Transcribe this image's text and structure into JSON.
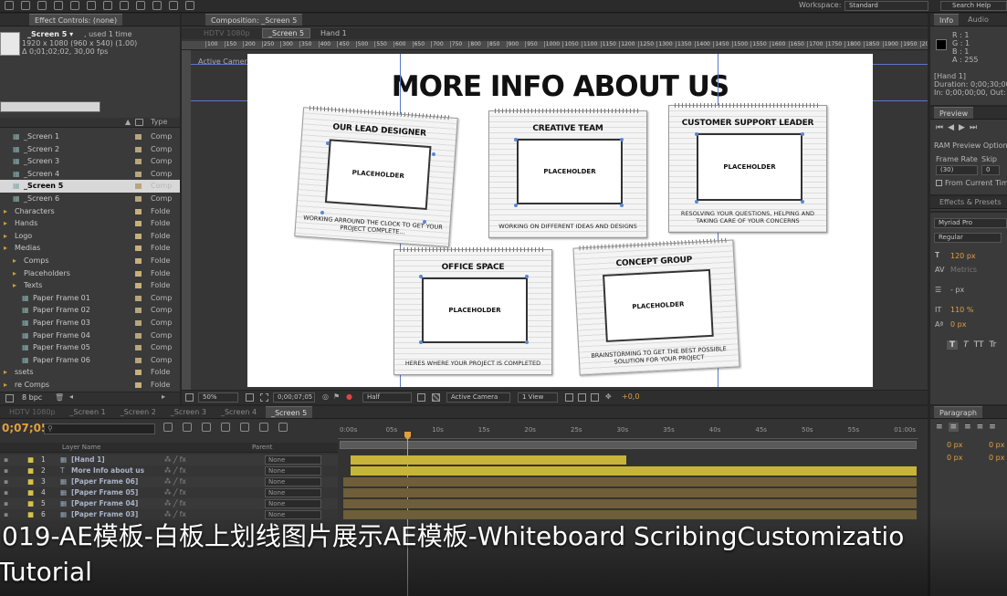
{
  "top_bar": {
    "workspace_label": "Workspace:",
    "workspace_value": "Standard",
    "search_help": "Search Help"
  },
  "effect_controls": {
    "tab": "Effect Controls: (none)"
  },
  "project": {
    "name": "_Screen 5 ▾",
    "used": ", used 1 time",
    "dims": "1920 x 1080  (960 x 540) (1.00)",
    "duration": "Δ 0;01;02;02, 30,00 fps",
    "col_type": "Type",
    "items": [
      {
        "name": "_Screen 1",
        "type": "Comp",
        "indent": 1,
        "kind": "comp"
      },
      {
        "name": "_Screen 2",
        "type": "Comp",
        "indent": 1,
        "kind": "comp"
      },
      {
        "name": "_Screen 3",
        "type": "Comp",
        "indent": 1,
        "kind": "comp"
      },
      {
        "name": "_Screen 4",
        "type": "Comp",
        "indent": 1,
        "kind": "comp"
      },
      {
        "name": "_Screen 5",
        "type": "Comp",
        "indent": 1,
        "kind": "comp",
        "selected": true
      },
      {
        "name": "_Screen 6",
        "type": "Comp",
        "indent": 1,
        "kind": "comp"
      },
      {
        "name": "Characters",
        "type": "Folde",
        "indent": 0,
        "kind": "folder"
      },
      {
        "name": "Hands",
        "type": "Folde",
        "indent": 0,
        "kind": "folder"
      },
      {
        "name": "Logo",
        "type": "Folde",
        "indent": 0,
        "kind": "folder"
      },
      {
        "name": "Medias",
        "type": "Folde",
        "indent": 0,
        "kind": "folder"
      },
      {
        "name": "Comps",
        "type": "Folde",
        "indent": 1,
        "kind": "folder"
      },
      {
        "name": "Placeholders",
        "type": "Folde",
        "indent": 1,
        "kind": "folder"
      },
      {
        "name": "Texts",
        "type": "Folde",
        "indent": 1,
        "kind": "folder"
      },
      {
        "name": "Paper Frame 01",
        "type": "Comp",
        "indent": 2,
        "kind": "comp"
      },
      {
        "name": "Paper Frame 02",
        "type": "Comp",
        "indent": 2,
        "kind": "comp"
      },
      {
        "name": "Paper Frame 03",
        "type": "Comp",
        "indent": 2,
        "kind": "comp"
      },
      {
        "name": "Paper Frame 04",
        "type": "Comp",
        "indent": 2,
        "kind": "comp"
      },
      {
        "name": "Paper Frame 05",
        "type": "Comp",
        "indent": 2,
        "kind": "comp"
      },
      {
        "name": "Paper Frame 06",
        "type": "Comp",
        "indent": 2,
        "kind": "comp"
      },
      {
        "name": "ssets",
        "type": "Folde",
        "indent": 0,
        "kind": "folder"
      },
      {
        "name": "re Comps",
        "type": "Folde",
        "indent": 0,
        "kind": "folder"
      }
    ],
    "bpc": "8 bpc"
  },
  "composition": {
    "tab": "Composition: _Screen 5",
    "breadcrumb_dim": "HDTV 1080p",
    "breadcrumb": "_Screen 5",
    "breadcrumb_next": "Hand 1",
    "active_camera": "Active Camera",
    "ruler": [
      "100",
      "150",
      "200",
      "250",
      "300",
      "350",
      "400",
      "450",
      "500",
      "550",
      "600",
      "650",
      "700",
      "750",
      "800",
      "850",
      "900",
      "950",
      "1000",
      "1050",
      "1100",
      "1150",
      "1200",
      "1250",
      "1300",
      "1350",
      "1400",
      "1450",
      "1500",
      "1550",
      "1600",
      "1650",
      "1700",
      "1750",
      "1800",
      "1850",
      "1900",
      "1950",
      "2000"
    ],
    "zoom": "50%",
    "timecode": "0;00;07;05",
    "resolution": "Half",
    "camera": "Active Camera",
    "view": "1 View",
    "exposure": "+0,0"
  },
  "canvas": {
    "title": "MORE INFO ABOUT US",
    "cards": [
      {
        "title": "OUR LEAD DESIGNER",
        "placeholder": "PLACEHOLDER",
        "caption": "WORKING ARROUND THE CLOCK TO GET YOUR PROJECT COMPLETE..."
      },
      {
        "title": "CREATIVE TEAM",
        "placeholder": "PLACEHOLDER",
        "caption": "WORKING ON DIFFERENT IDEAS AND DESIGNS"
      },
      {
        "title": "CUSTOMER SUPPORT LEADER",
        "placeholder": "PLACEHOLDER",
        "caption": "RESOLVING YOUR QUESTIONS, HELPING AND TAKING CARE OF YOUR CONCERNS"
      },
      {
        "title": "OFFICE SPACE",
        "placeholder": "PLACEHOLDER",
        "caption": "HERES WHERE YOUR PROJECT IS COMPLETED"
      },
      {
        "title": "CONCEPT GROUP",
        "placeholder": "PLACEHOLDER",
        "caption": "BRAINSTORMING TO GET THE BEST POSSIBLE SOLUTION FOR YOUR PROJECT"
      }
    ]
  },
  "info": {
    "tab": "Info",
    "tab2": "Audio",
    "r": "R : 1",
    "g": "G : 1",
    "b": "B : 1",
    "a": "A : 255",
    "layer": "[Hand 1]",
    "duration": "Duration: 0;00;30;00",
    "inout": "In: 0;00;00;00, Out: 0"
  },
  "preview": {
    "tab": "Preview",
    "ram": "RAM Preview Option",
    "frame_rate": "Frame Rate",
    "skip": "Skip",
    "frame_rate_val": "(30)",
    "skip_val": "0",
    "from_current": "From Current Time"
  },
  "effects": {
    "tab": "Effects & Presets"
  },
  "character": {
    "font": "Myriad Pro",
    "style": "Regular",
    "size": "120 px",
    "metrics": "Metrics",
    "unit": "- px",
    "vscale": "110 %",
    "baseline": "0 px",
    "b1": "T",
    "b2": "T",
    "b3": "TT",
    "b4": "Tr"
  },
  "timeline": {
    "tabs": [
      "HDTV 1080p",
      "_Screen 1",
      "_Screen 2",
      "_Screen 3",
      "_Screen 4",
      "_Screen 5"
    ],
    "timecode": "0;07;05",
    "ticks": [
      "0:00s",
      "05s",
      "10s",
      "15s",
      "20s",
      "25s",
      "30s",
      "35s",
      "40s",
      "45s",
      "50s",
      "55s",
      "01:00s"
    ],
    "col_name": "Layer Name",
    "col_parent": "Parent",
    "layers": [
      {
        "num": "1",
        "name": "[Hand 1]",
        "parent": "None"
      },
      {
        "num": "2",
        "name": "More Info about us",
        "parent": "None"
      },
      {
        "num": "3",
        "name": "[Paper Frame 06]",
        "parent": "None"
      },
      {
        "num": "4",
        "name": "[Paper Frame 05]",
        "parent": "None"
      },
      {
        "num": "5",
        "name": "[Paper Frame 04]",
        "parent": "None"
      },
      {
        "num": "6",
        "name": "[Paper Frame 03]",
        "parent": "None"
      }
    ]
  },
  "paragraph": {
    "tab": "Paragraph",
    "v1": "0 px",
    "v2": "0 px",
    "v3": "0 px",
    "v4": "0 px"
  },
  "overlay": {
    "line1": "019-AE模板-白板上划线图片展示AE模板-Whiteboard ScribingCustomizatio",
    "line2": "Tutorial"
  }
}
